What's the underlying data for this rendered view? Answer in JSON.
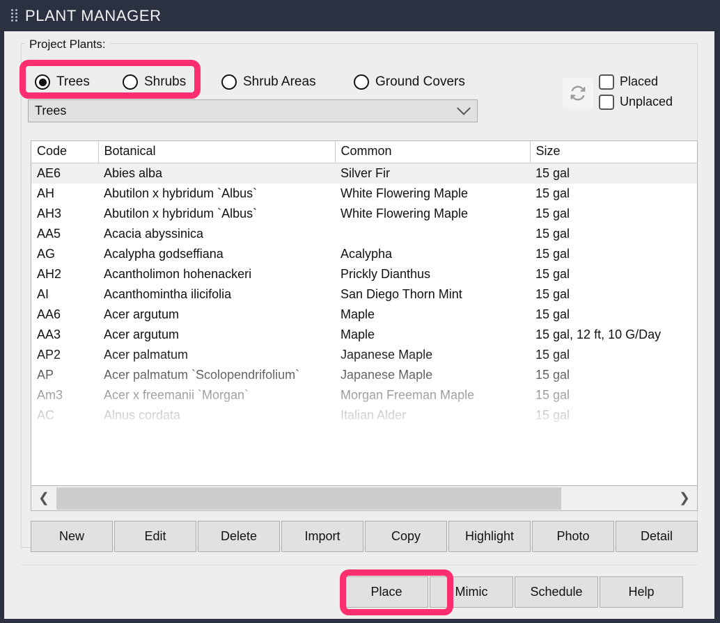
{
  "window": {
    "title": "PLANT MANAGER",
    "drag_handle_icon": "drag-dots-icon"
  },
  "group": {
    "legend": "Project Plants:"
  },
  "filters": {
    "radios": [
      {
        "label": "Trees",
        "checked": true
      },
      {
        "label": "Shrubs",
        "checked": false
      },
      {
        "label": "Shrub Areas",
        "checked": false
      },
      {
        "label": "Ground Covers",
        "checked": false
      }
    ],
    "combo": {
      "value": "Trees",
      "chevron_icon": "chevron-down-icon"
    },
    "refresh_icon": "refresh-icon",
    "checkboxes": [
      {
        "label": "Placed",
        "checked": false
      },
      {
        "label": "Unplaced",
        "checked": false
      }
    ]
  },
  "table": {
    "columns": [
      "Code",
      "Botanical",
      "Common",
      "Size"
    ],
    "rows": [
      {
        "code": "AE6",
        "botanical": "Abies alba",
        "common": "Silver Fir",
        "size": "15 gal",
        "selected": true
      },
      {
        "code": "AH",
        "botanical": "Abutilon x hybridum `Albus`",
        "common": "White Flowering Maple",
        "size": "15 gal",
        "selected": false
      },
      {
        "code": "AH3",
        "botanical": "Abutilon x hybridum `Albus`",
        "common": "White Flowering Maple",
        "size": "15 gal",
        "selected": false
      },
      {
        "code": "AA5",
        "botanical": "Acacia abyssinica",
        "common": "",
        "size": "15 gal",
        "selected": false
      },
      {
        "code": "AG",
        "botanical": "Acalypha godseffiana",
        "common": "Acalypha",
        "size": "15 gal",
        "selected": false
      },
      {
        "code": "AH2",
        "botanical": "Acantholimon hohenackeri",
        "common": "Prickly Dianthus",
        "size": "15 gal",
        "selected": false
      },
      {
        "code": "AI",
        "botanical": "Acanthomintha ilicifolia",
        "common": "San Diego Thorn Mint",
        "size": "15 gal",
        "selected": false
      },
      {
        "code": "AA6",
        "botanical": "Acer argutum",
        "common": "Maple",
        "size": "15 gal",
        "selected": false
      },
      {
        "code": "AA3",
        "botanical": "Acer argutum",
        "common": "Maple",
        "size": "15 gal, 12 ft, 10 G/Day",
        "selected": false
      },
      {
        "code": "AP2",
        "botanical": "Acer palmatum",
        "common": "Japanese Maple",
        "size": "15 gal",
        "selected": false
      },
      {
        "code": "AP",
        "botanical": "Acer palmatum  `Scolopendrifolium`",
        "common": "Japanese Maple",
        "size": "15 gal",
        "selected": false
      },
      {
        "code": "Am3",
        "botanical": "Acer x freemanii `Morgan`",
        "common": "Morgan Freeman Maple",
        "size": "15 gal",
        "selected": false
      },
      {
        "code": "AC",
        "botanical": "Alnus cordata",
        "common": "Italian Alder",
        "size": "15 gal",
        "selected": false
      }
    ]
  },
  "hscroll": {
    "left_arrow_icon": "chevron-left-icon",
    "right_arrow_icon": "chevron-right-icon"
  },
  "toolbar": {
    "buttons": [
      "New",
      "Edit",
      "Delete",
      "Import",
      "Copy",
      "Highlight",
      "Photo",
      "Detail"
    ]
  },
  "actions": {
    "buttons": [
      "Place",
      "Mimic",
      "Schedule",
      "Help"
    ],
    "highlighted": "Place"
  },
  "colors": {
    "highlight": "#ff2e6e",
    "titlebar": "#2b3140",
    "panel": "#eeeeee"
  }
}
